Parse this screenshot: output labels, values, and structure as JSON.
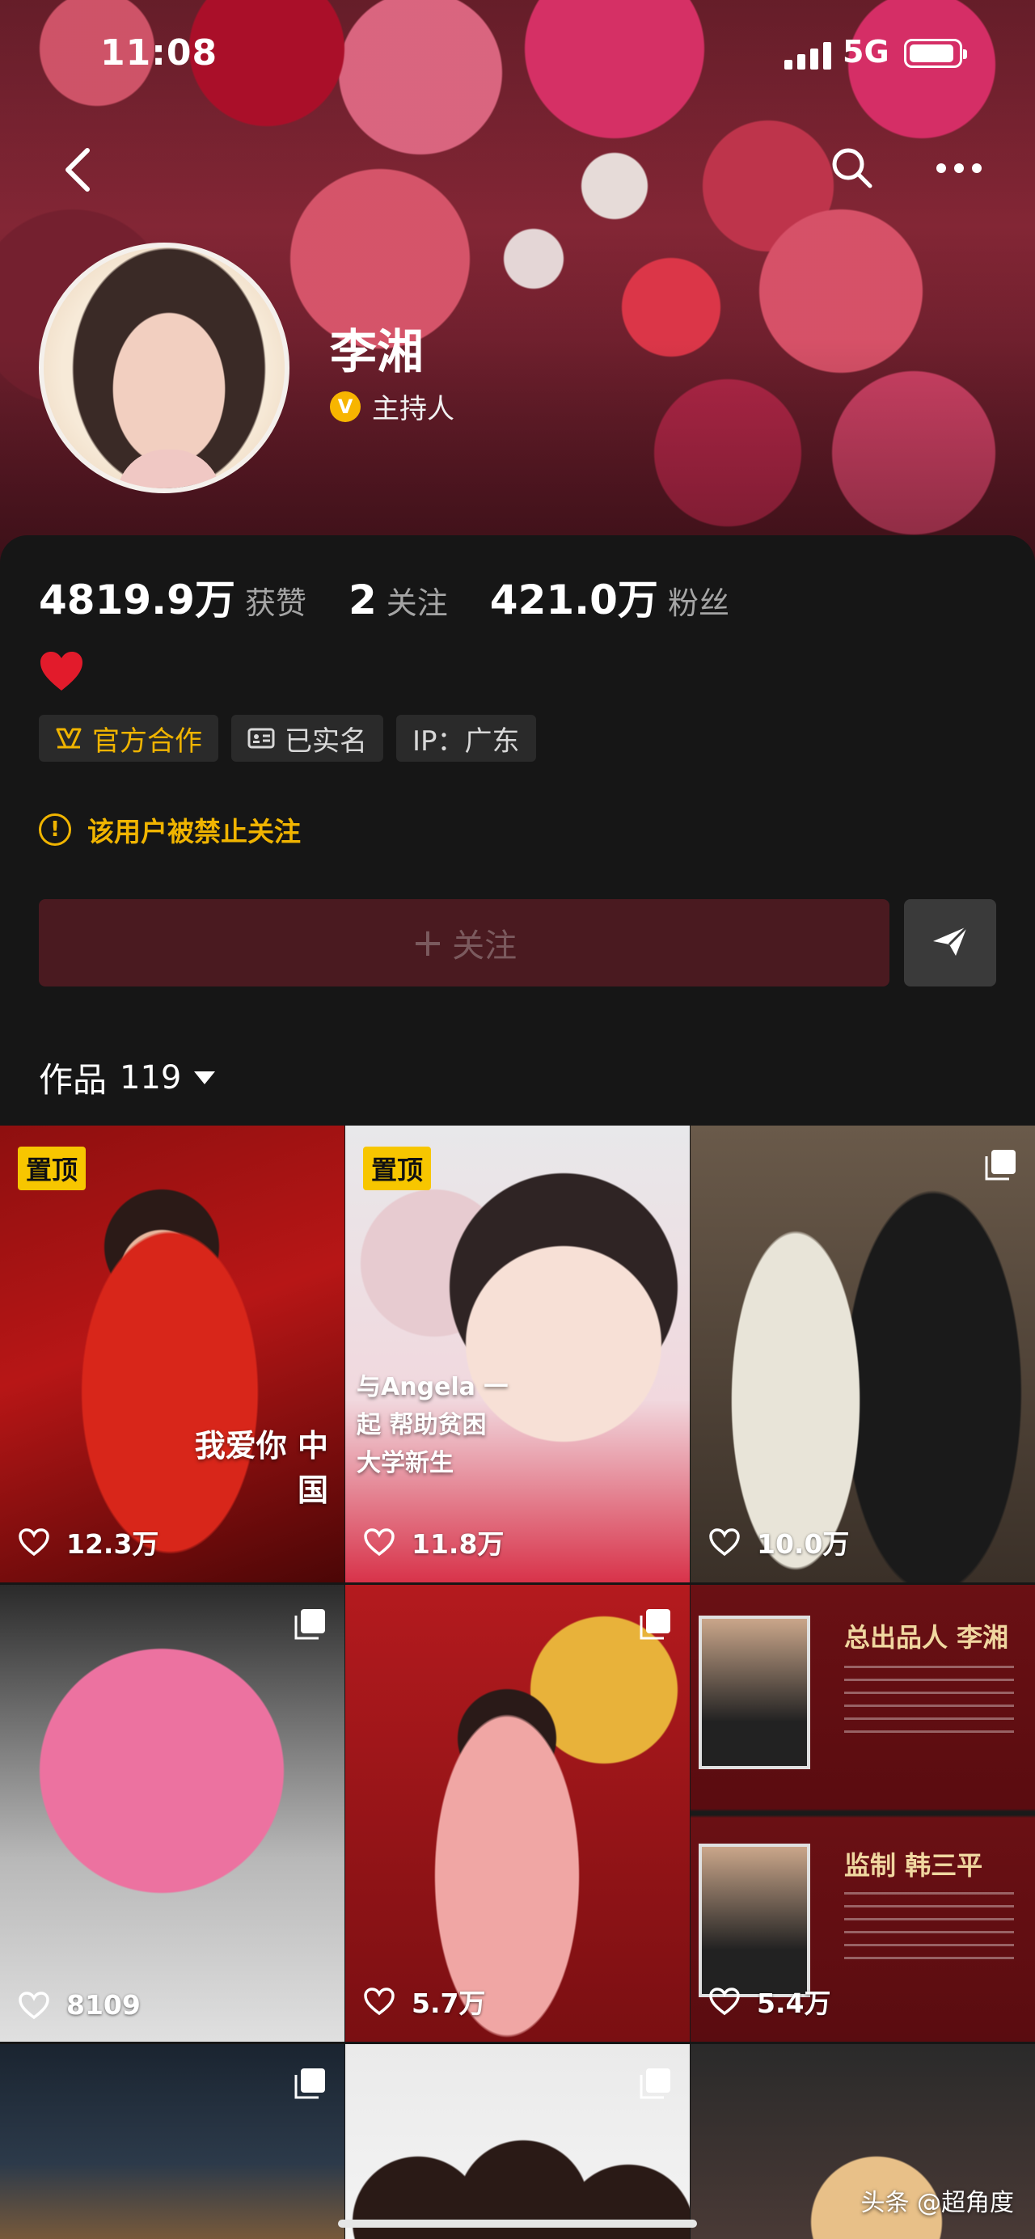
{
  "status_bar": {
    "time": "11:08",
    "network": "5G"
  },
  "profile": {
    "name": "李湘",
    "verification": "主持人",
    "stats": [
      {
        "value": "4819.9万",
        "label": "获赞"
      },
      {
        "value": "2",
        "label": "关注"
      },
      {
        "value": "421.0万",
        "label": "粉丝"
      }
    ],
    "tags": [
      {
        "label": "官方合作",
        "icon": "official-partner-icon"
      },
      {
        "label": "已实名",
        "icon": "id-card-icon"
      },
      {
        "label": "IP：广东",
        "icon": ""
      }
    ],
    "notice": "该用户被禁止关注",
    "follow_label": "关注",
    "works_label": "作品",
    "works_count": "119"
  },
  "videos": [
    {
      "pinned": "置顶",
      "likes": "12.3万",
      "caption": "我爱你 中国"
    },
    {
      "pinned": "置顶",
      "likes": "11.8万",
      "caption": "与Angela 一起 帮助贫困 大学新生"
    },
    {
      "likes": "10.0万"
    },
    {
      "likes": "8109"
    },
    {
      "likes": "5.7万"
    },
    {
      "likes": "5.4万",
      "title_top": "总出品人 李湘",
      "title_bottom": "监制 韩三平"
    },
    {
      "likes": ""
    },
    {
      "likes": ""
    },
    {
      "likes": ""
    }
  ],
  "watermark": "头条 @超角度",
  "colors": {
    "accent": "#f0b400",
    "follow_bg": "#4a1a20",
    "background": "#161616"
  }
}
